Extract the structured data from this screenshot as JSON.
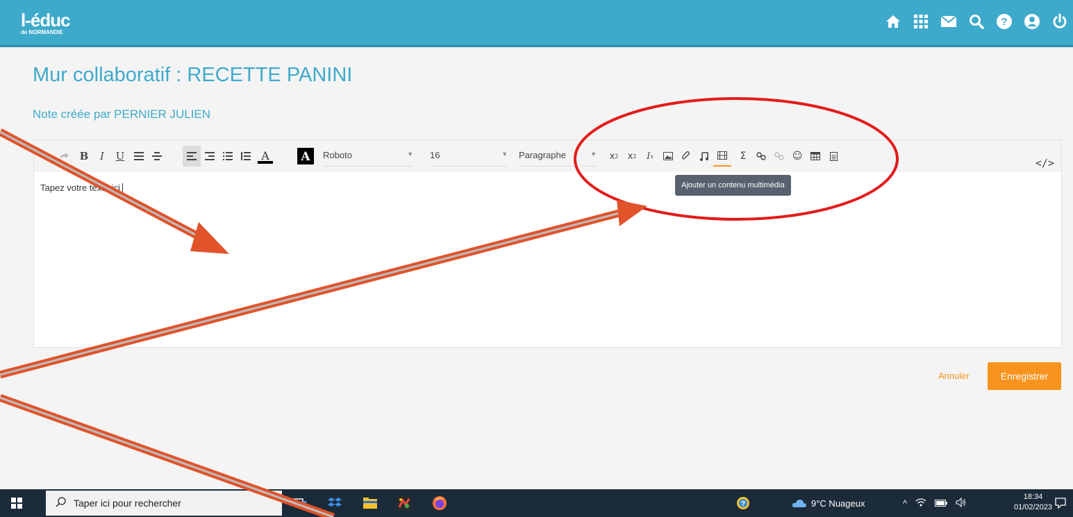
{
  "header": {
    "logo_main": "l-éduc",
    "logo_sub": "de NORMANDIE",
    "icons": [
      "home-icon",
      "apps-grid-icon",
      "mail-icon",
      "search-icon",
      "help-icon",
      "user-icon",
      "power-icon"
    ]
  },
  "page": {
    "title": "Mur collaboratif : RECETTE PANINI",
    "subtitle": "Note créée par PERNIER JULIEN"
  },
  "toolbar": {
    "font_family": "Roboto",
    "font_size": "16",
    "block_format": "Paragraphe",
    "tooltip": "Ajouter un contenu multimédia",
    "code_label": "</>"
  },
  "editor": {
    "placeholder": "Tapez votre texte ici"
  },
  "actions": {
    "cancel_label": "Annuler",
    "save_label": "Enregistrer"
  },
  "taskbar": {
    "search_placeholder": "Taper ici pour rechercher",
    "weather": "9°C  Nuageux",
    "time": "18:34",
    "date": "01/02/2023"
  },
  "colors": {
    "brand": "#3eaacb",
    "accent": "#f7931e",
    "annotation_circle": "#e41b1b",
    "annotation_arrow": "#e0532b"
  }
}
